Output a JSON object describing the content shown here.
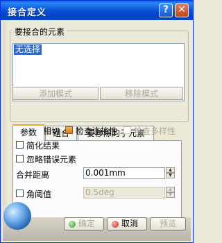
{
  "window": {
    "title": "接合定义",
    "help_glyph": "?",
    "close_glyph": "✕"
  },
  "elements_group": {
    "legend": "要接合的元素",
    "selected_item": "无选择",
    "add_mode_label": "添加模式",
    "remove_mode_label": "移除模式"
  },
  "tabs": [
    {
      "label": "参数",
      "active": true
    },
    {
      "label": "组合",
      "active": false
    },
    {
      "label": "要移除的子元素",
      "active": false
    }
  ],
  "parameters": {
    "check_tangency": {
      "label": "检查相切",
      "checked": false
    },
    "check_connectivity": {
      "label": "检查连接性",
      "checked": true
    },
    "check_manifold": {
      "label": "检查多样性",
      "checked": false,
      "disabled": true
    },
    "simplify_result": {
      "label": "简化结果",
      "checked": false
    },
    "ignore_errors": {
      "label": "忽略错误元素",
      "checked": false
    },
    "merge_distance": {
      "label": "合并距离",
      "value": "0.001mm"
    },
    "angular_threshold": {
      "label": "角阈值",
      "value": "0.5deg",
      "checked": false,
      "disabled": true
    }
  },
  "footer": {
    "ok_label": "确定",
    "cancel_label": "取消",
    "preview_label": "预览"
  },
  "colors": {
    "title_bar": "#0a57d8",
    "selection": "#316ac5",
    "checked_box": "#e8962f",
    "ok_dot": "#2a9a2a",
    "cancel_dot": "#c8221a"
  }
}
